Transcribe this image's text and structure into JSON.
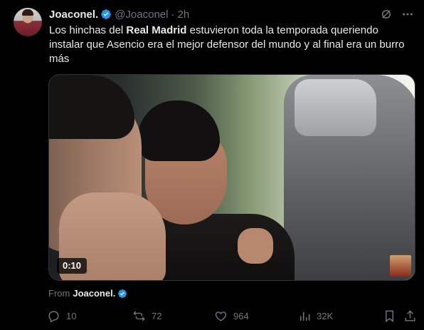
{
  "tweet": {
    "display_name": "Joaconel.",
    "handle": "@Joaconel",
    "separator": "·",
    "time": "2h",
    "text_before": "Los hinchas del ",
    "text_bold": "Real Madrid",
    "text_after": " estuvieron toda la temporada queriendo instalar que Asencio era el mejor defensor del mundo y al final era un burro más",
    "video_time": "0:10",
    "from_label": "From",
    "from_name": "Joaconel."
  },
  "actions": {
    "replies": "10",
    "reposts": "72",
    "likes": "964",
    "views": "32K"
  },
  "icons": [
    "grok-icon",
    "more-icon",
    "verified-icon",
    "reply-icon",
    "repost-icon",
    "like-icon",
    "views-icon",
    "bookmark-icon",
    "share-icon"
  ],
  "colors": {
    "background": "#000000",
    "text": "#e7e9ea",
    "muted": "#71767b",
    "verified": "#1d9bf0"
  }
}
